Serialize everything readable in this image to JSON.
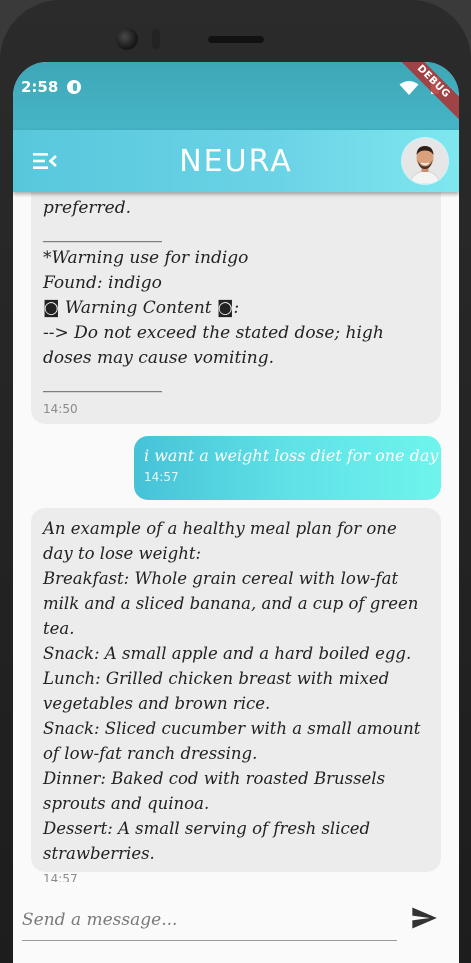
{
  "status_bar": {
    "time": "2:58"
  },
  "debug_banner": "DEBUG",
  "app_bar": {
    "title": "NEURA"
  },
  "messages": [
    {
      "role": "assistant",
      "text": "preferred.\n______________\n*Warning use for indigo\nFound: indigo\n◙ Warning Content ◙:\n--> Do not exceed the stated dose; high doses may cause vomiting.\n______________",
      "time": "14:50"
    },
    {
      "role": "user",
      "text": "i want a weight loss diet for one day",
      "time": "14:57"
    },
    {
      "role": "assistant",
      "text": "An example of a healthy meal plan for one day to lose weight:\nBreakfast: Whole grain cereal with low-fat milk and a sliced banana, and a cup of green tea.\nSnack: A small apple and a hard boiled egg.\nLunch: Grilled chicken breast with mixed vegetables and brown rice.\nSnack: Sliced cucumber with a small amount of low-fat ranch dressing.\nDinner: Baked cod with roasted Brussels sprouts and quinoa.\nDessert: A small serving of fresh sliced strawberries.",
      "time": "14:57"
    }
  ],
  "composer": {
    "placeholder": "Send a message..."
  },
  "icons": {
    "menu": "menu-collapse-icon",
    "send": "send-icon",
    "avatar": "user-avatar"
  },
  "colors": {
    "app_bar_start": "#58c7dc",
    "app_bar_end": "#7fe7ee",
    "ai_bubble": "#ececec",
    "user_bubble_start": "#46c2d8",
    "user_bubble_end": "#6ff4ed"
  }
}
